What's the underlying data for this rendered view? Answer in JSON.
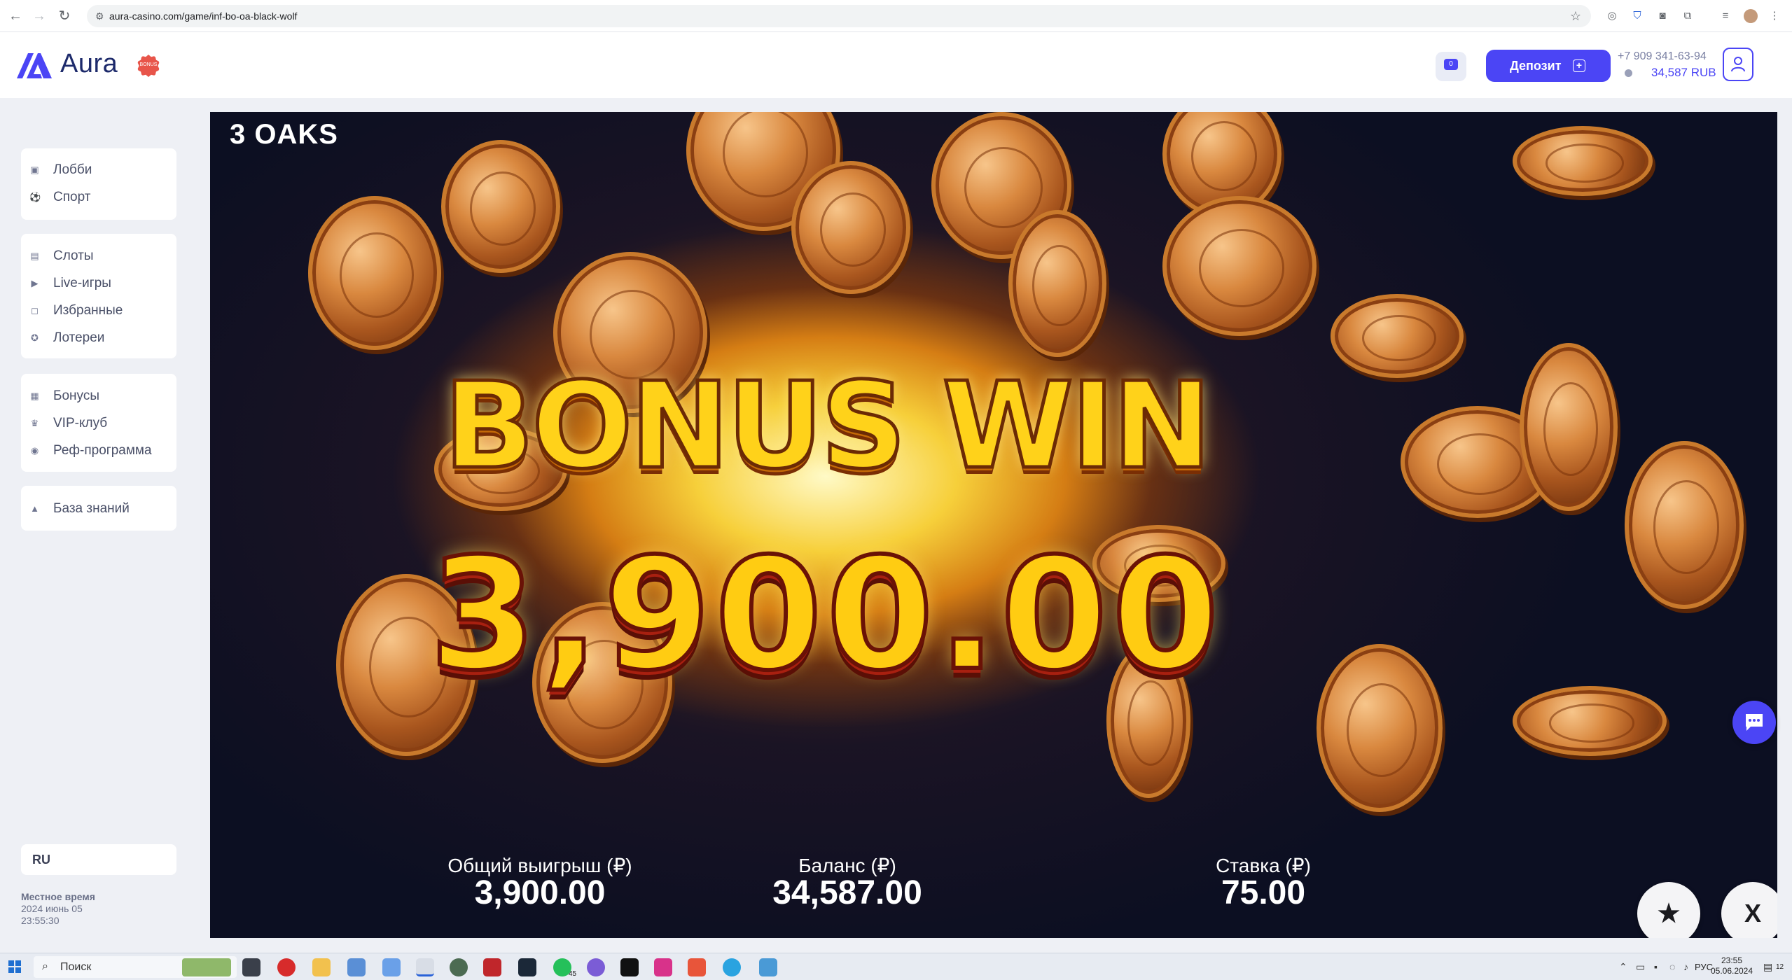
{
  "browser": {
    "url": "aura-casino.com/game/inf-bo-oa-black-wolf",
    "back_icon": "←",
    "forward_icon": "→",
    "reload_icon": "↻",
    "star_icon": "☆"
  },
  "header": {
    "logo_text": "Aura",
    "badge_text": "BONUS",
    "notifications_count": "0",
    "deposit_label": "Депозит",
    "phone": "+7 909 341-63-94",
    "balance": "34,587 RUB",
    "accent_color": "#4b45f5"
  },
  "sidebar": {
    "group1": [
      {
        "label": "Лобби",
        "icon": "lobby-icon"
      },
      {
        "label": "Спорт",
        "icon": "sport-icon"
      }
    ],
    "group2": [
      {
        "label": "Слоты",
        "icon": "slots-icon"
      },
      {
        "label": "Live-игры",
        "icon": "live-icon"
      },
      {
        "label": "Избранные",
        "icon": "favorites-icon"
      },
      {
        "label": "Лотереи",
        "icon": "lottery-icon"
      }
    ],
    "group3": [
      {
        "label": "Бонусы",
        "icon": "bonus-icon"
      },
      {
        "label": "VIP-клуб",
        "icon": "crown-icon"
      },
      {
        "label": "Реф-программа",
        "icon": "referral-icon"
      }
    ],
    "group4": [
      {
        "label": "База знаний",
        "icon": "knowledge-icon"
      }
    ],
    "language": "RU",
    "local_time_label": "Местное время",
    "local_date": "2024 июнь 05",
    "local_time": "23:55:30"
  },
  "game": {
    "provider_title": "3 OAKS",
    "bonus_title": "BONUS WIN",
    "win_amount": "3,900.00",
    "total_win_label": "Общий выигрыш (₽)",
    "total_win_value": "3,900.00",
    "balance_label": "Баланс (₽)",
    "balance_value": "34,587.00",
    "bet_label": "Ставка (₽)",
    "bet_value": "75.00",
    "favorite_icon": "★",
    "close_label": "X"
  },
  "taskbar": {
    "search_placeholder": "Поиск",
    "whatsapp_badge": "45",
    "lang": "РУС",
    "time": "23:55",
    "date": "05.06.2024",
    "notif_count": "12"
  }
}
